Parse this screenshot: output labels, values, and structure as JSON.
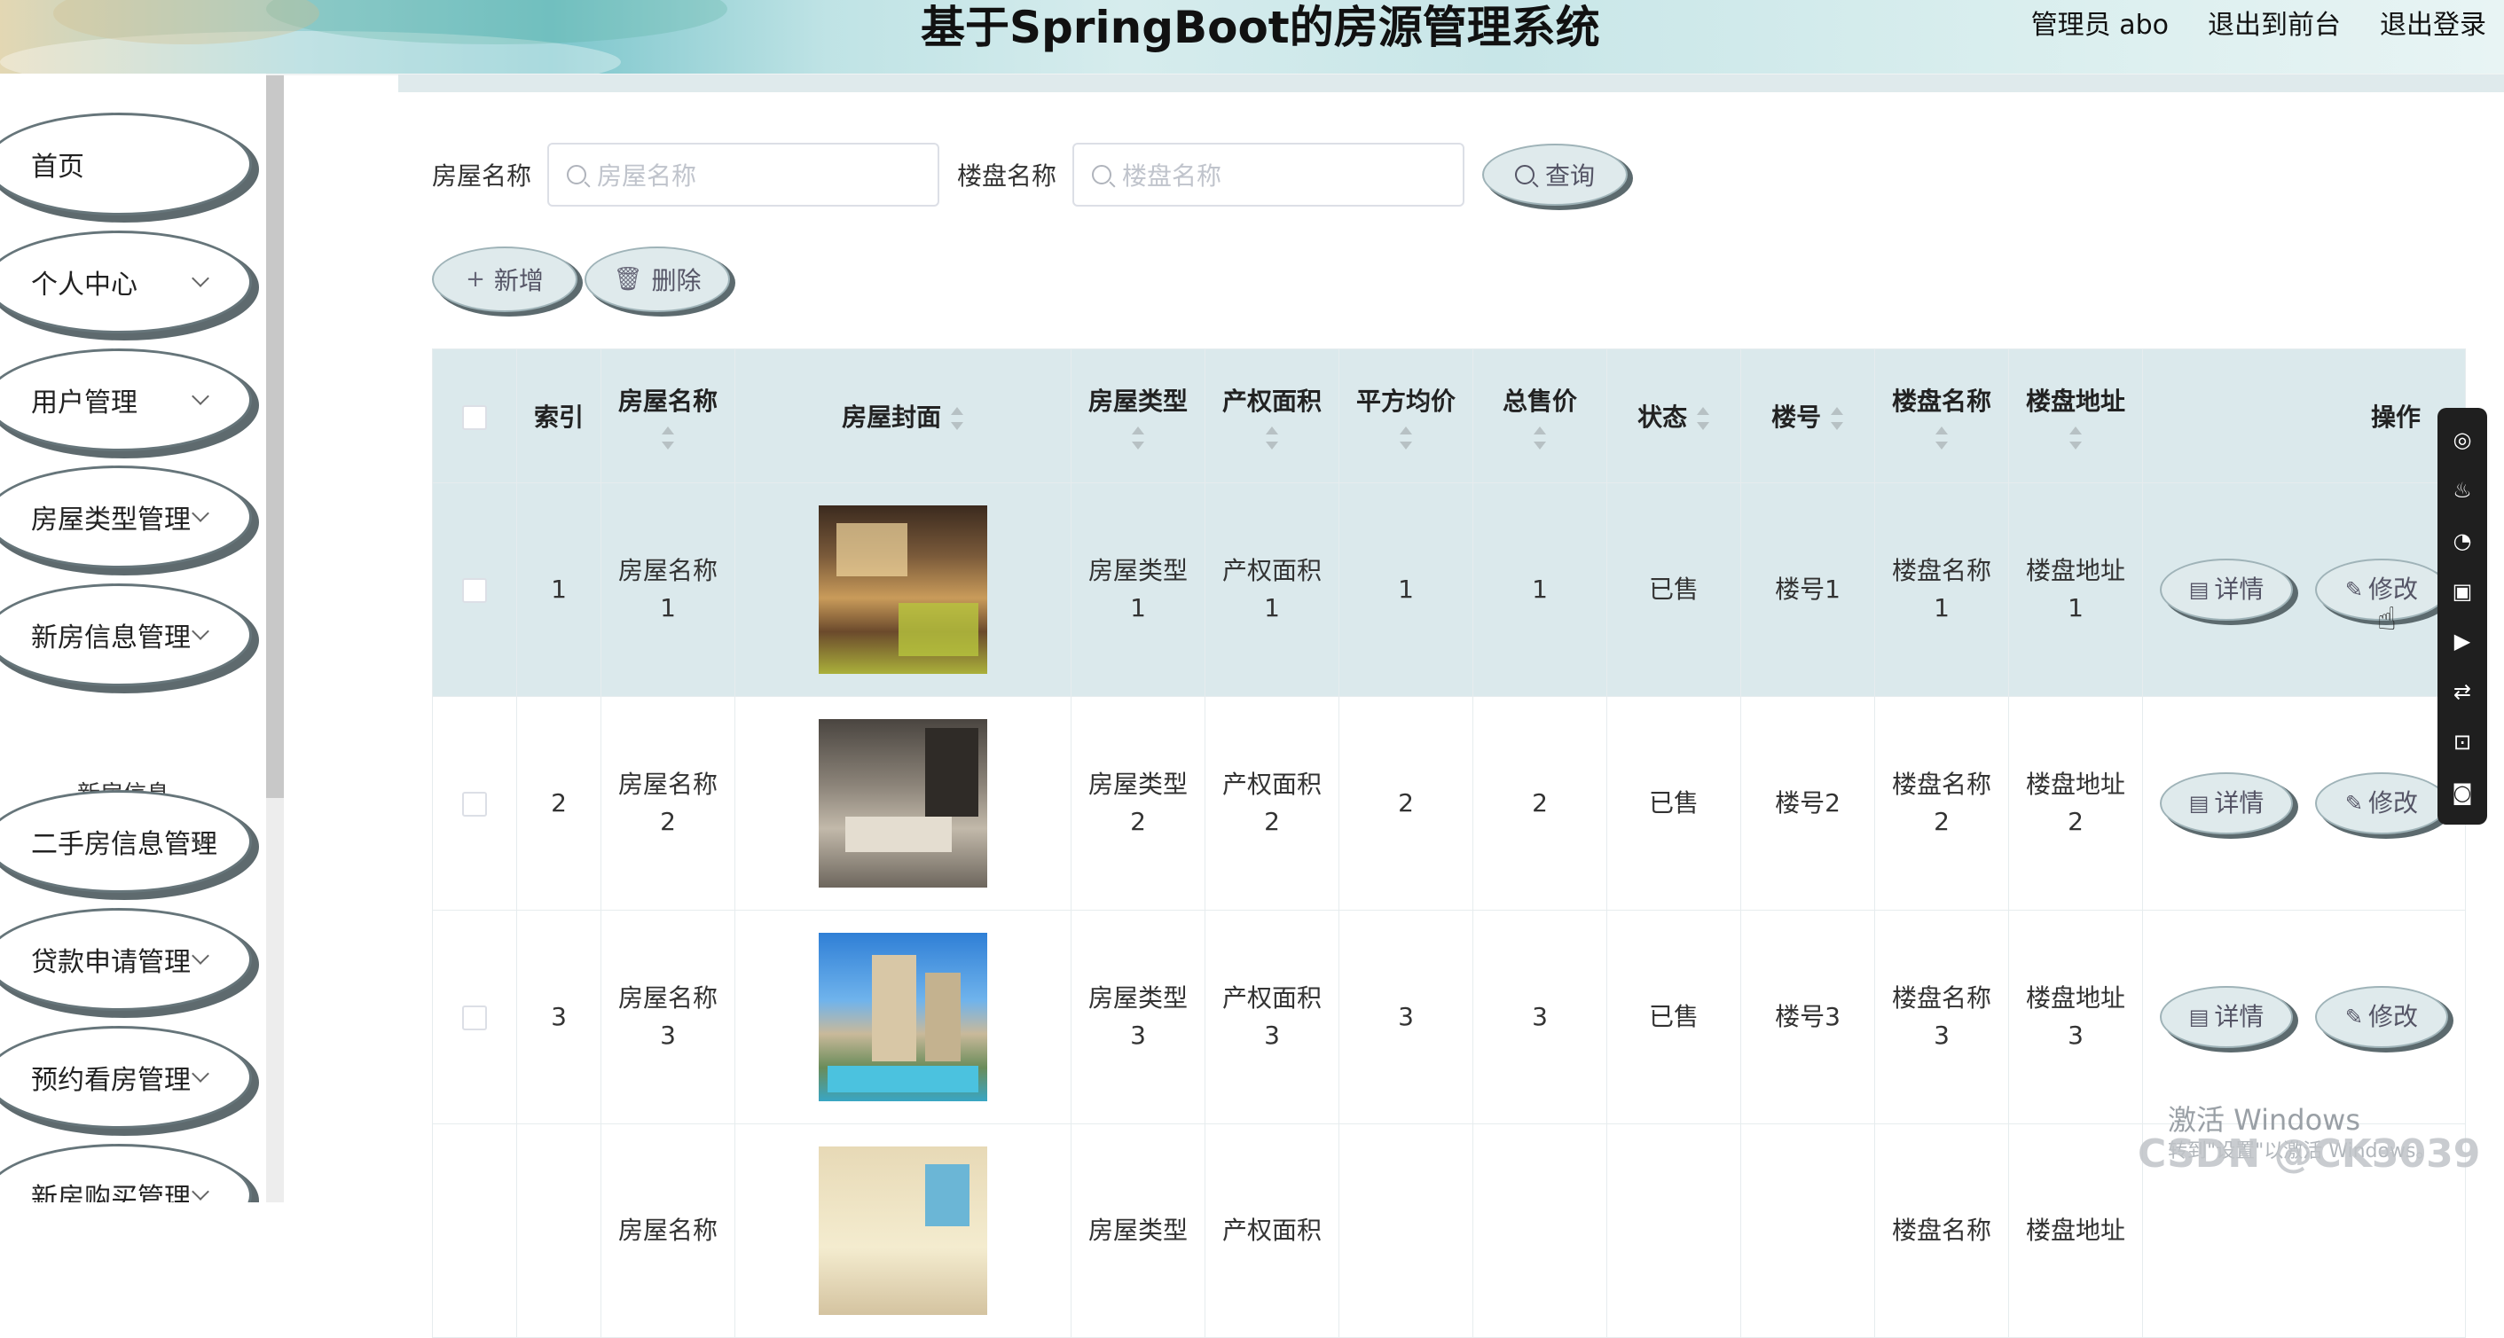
{
  "header": {
    "title": "基于SpringBoot的房源管理系统",
    "user": "管理员 abo",
    "to_front": "退出到前台",
    "logout": "退出登录"
  },
  "sidebar": {
    "items": [
      {
        "label": "首页",
        "has_arrow": false
      },
      {
        "label": "个人中心",
        "has_arrow": true
      },
      {
        "label": "用户管理",
        "has_arrow": true
      },
      {
        "label": "房屋类型管理",
        "has_arrow": true
      },
      {
        "label": "新房信息管理",
        "has_arrow": true
      },
      {
        "label": "二手房信息管理",
        "has_arrow": true
      },
      {
        "label": "贷款申请管理",
        "has_arrow": true
      },
      {
        "label": "预约看房管理",
        "has_arrow": true
      },
      {
        "label": "新房购买管理",
        "has_arrow": true
      }
    ],
    "submenu": "新房信息"
  },
  "search": {
    "house_name_label": "房屋名称",
    "house_name_placeholder": "房屋名称",
    "building_name_label": "楼盘名称",
    "building_name_placeholder": "楼盘名称",
    "query_label": "查询"
  },
  "actions": {
    "add_label": "新增",
    "delete_label": "删除"
  },
  "table": {
    "columns": [
      "索引",
      "房屋名称",
      "房屋封面",
      "房屋类型",
      "产权面积",
      "平方均价",
      "总售价",
      "状态",
      "楼号",
      "楼盘名称",
      "楼盘地址",
      "操作"
    ],
    "rows": [
      {
        "index": "1",
        "name_1": "房屋名称",
        "name_2": "1",
        "type_1": "房屋类型",
        "type_2": "1",
        "area_1": "产权面积",
        "area_2": "1",
        "avg_price": "1",
        "total_price": "1",
        "status": "已售",
        "building_no": "楼号1",
        "estate_1": "楼盘名称",
        "estate_2": "1",
        "addr_1": "楼盘地址",
        "addr_2": "1"
      },
      {
        "index": "2",
        "name_1": "房屋名称",
        "name_2": "2",
        "type_1": "房屋类型",
        "type_2": "2",
        "area_1": "产权面积",
        "area_2": "2",
        "avg_price": "2",
        "total_price": "2",
        "status": "已售",
        "building_no": "楼号2",
        "estate_1": "楼盘名称",
        "estate_2": "2",
        "addr_1": "楼盘地址",
        "addr_2": "2"
      },
      {
        "index": "3",
        "name_1": "房屋名称",
        "name_2": "3",
        "type_1": "房屋类型",
        "type_2": "3",
        "area_1": "产权面积",
        "area_2": "3",
        "avg_price": "3",
        "total_price": "3",
        "status": "已售",
        "building_no": "楼号3",
        "estate_1": "楼盘名称",
        "estate_2": "3",
        "addr_1": "楼盘地址",
        "addr_2": "3"
      },
      {
        "index": "",
        "name_1": "房屋名称",
        "name_2": "",
        "type_1": "房屋类型",
        "type_2": "",
        "area_1": "产权面积",
        "area_2": "",
        "avg_price": "",
        "total_price": "",
        "status": "",
        "building_no": "",
        "estate_1": "楼盘名称",
        "estate_2": "",
        "addr_1": "楼盘地址",
        "addr_2": ""
      }
    ],
    "detail_label": "详情",
    "edit_label": "修改"
  },
  "overlay": {
    "activate_windows": "激活 Windows",
    "activate_hint": "转到\"设置\"以激活 Windows。",
    "csdn": "CSDN @CK3039"
  }
}
